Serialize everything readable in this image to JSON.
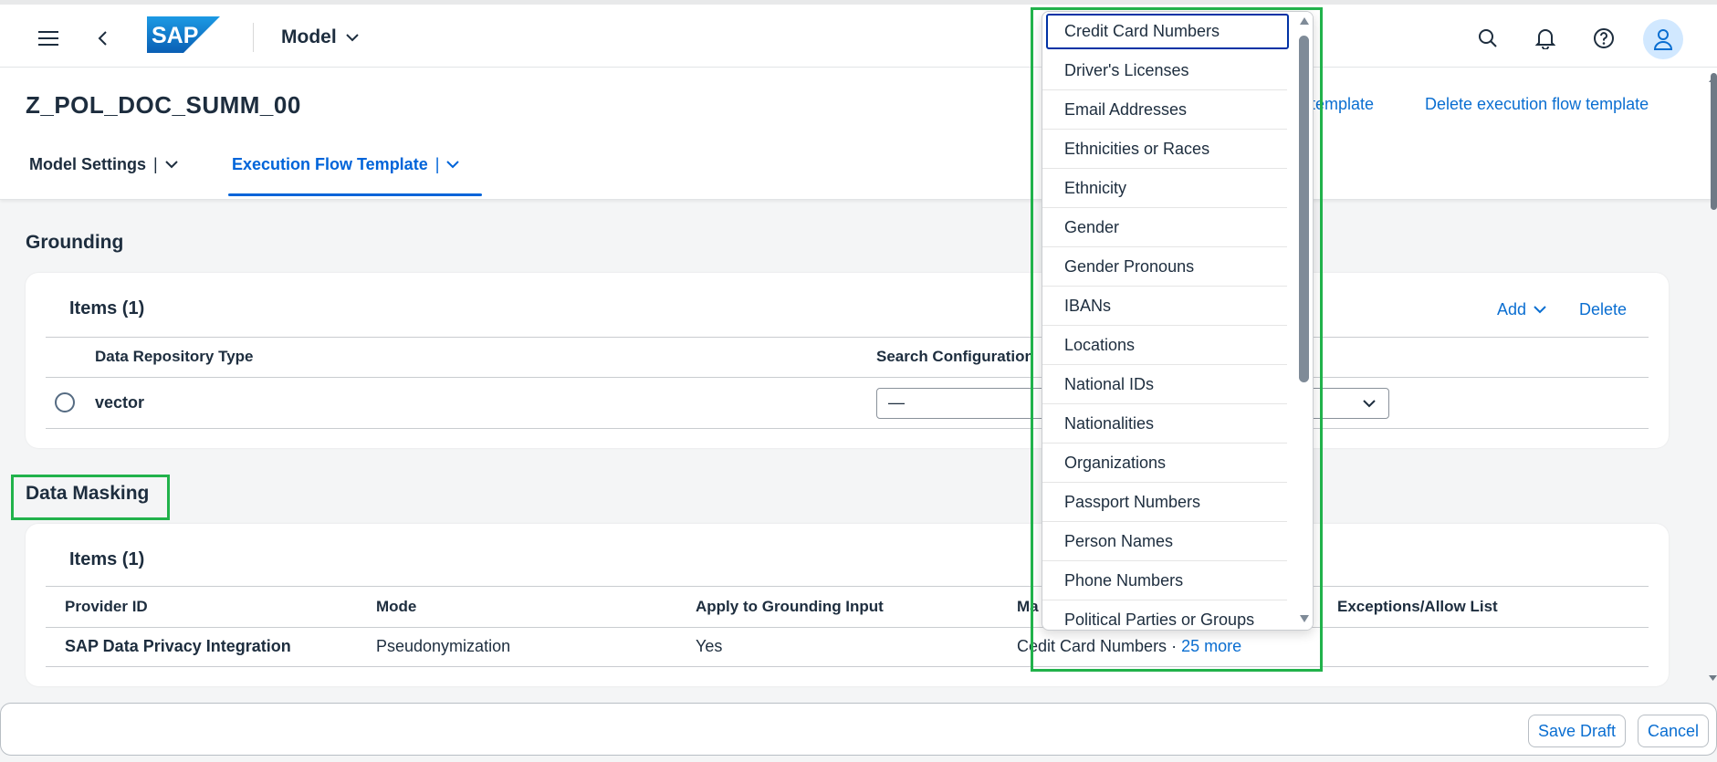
{
  "shell": {
    "title": "Model",
    "logo_text": "SAP"
  },
  "header": {
    "page_title": "Z_POL_DOC_SUMM_00",
    "link_partial": "w template",
    "link_delete": "Delete execution flow template",
    "tabs": [
      {
        "label": "Model Settings"
      },
      {
        "label": "Execution Flow Template"
      }
    ],
    "tab_sep": "|"
  },
  "grounding": {
    "section_title": "Grounding",
    "items_title": "Items (1)",
    "add_label": "Add",
    "delete_label": "Delete",
    "columns": [
      "Data Repository Type",
      "Search Configuration"
    ],
    "row": {
      "type": "vector",
      "search_value": "—"
    }
  },
  "masking": {
    "section_title": "Data Masking",
    "items_title": "Items (1)",
    "columns": [
      "Provider ID",
      "Mode",
      "Apply to Grounding Input",
      "Ma",
      "Exceptions/Allow List"
    ],
    "row": {
      "provider": "SAP Data Privacy Integration",
      "mode": "Pseudonymization",
      "apply": "Yes",
      "masked_prefix": "C",
      "masked_value": "edit Card Numbers",
      "dot": " · ",
      "more": "25 more"
    }
  },
  "dropdown": {
    "items": [
      "Credit Card Numbers",
      "Driver's Licenses",
      "Email Addresses",
      "Ethnicities or Races",
      "Ethnicity",
      "Gender",
      "Gender Pronouns",
      "IBANs",
      "Locations",
      "National IDs",
      "Nationalities",
      "Organizations",
      "Passport Numbers",
      "Person Names",
      "Phone Numbers",
      "Political Parties or Groups"
    ]
  },
  "footer": {
    "save_draft": "Save Draft",
    "cancel": "Cancel"
  },
  "colors": {
    "accent": "#0a6ed1",
    "highlight": "#21b24b",
    "brand": "#0a6ed1"
  }
}
